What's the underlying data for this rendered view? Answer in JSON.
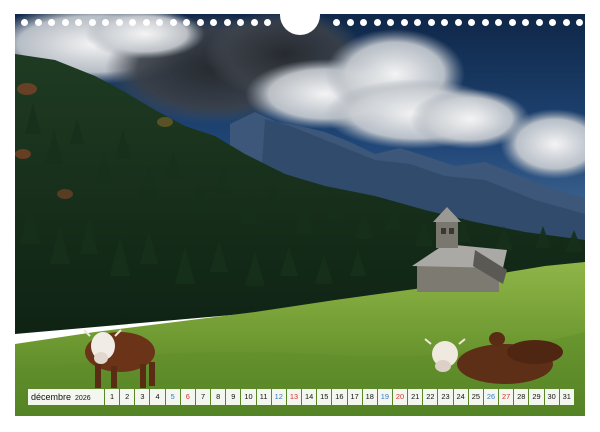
{
  "calendar": {
    "month": "décembre",
    "year": "2026",
    "days": [
      {
        "n": "1",
        "type": "weekday"
      },
      {
        "n": "2",
        "type": "weekday"
      },
      {
        "n": "3",
        "type": "weekday"
      },
      {
        "n": "4",
        "type": "weekday"
      },
      {
        "n": "5",
        "type": "sat"
      },
      {
        "n": "6",
        "type": "sun"
      },
      {
        "n": "7",
        "type": "weekday"
      },
      {
        "n": "8",
        "type": "weekday"
      },
      {
        "n": "9",
        "type": "weekday"
      },
      {
        "n": "10",
        "type": "weekday"
      },
      {
        "n": "11",
        "type": "weekday"
      },
      {
        "n": "12",
        "type": "sat"
      },
      {
        "n": "13",
        "type": "sun"
      },
      {
        "n": "14",
        "type": "weekday"
      },
      {
        "n": "15",
        "type": "weekday"
      },
      {
        "n": "16",
        "type": "weekday"
      },
      {
        "n": "17",
        "type": "weekday"
      },
      {
        "n": "18",
        "type": "weekday"
      },
      {
        "n": "19",
        "type": "sat"
      },
      {
        "n": "20",
        "type": "sun"
      },
      {
        "n": "21",
        "type": "weekday"
      },
      {
        "n": "22",
        "type": "weekday"
      },
      {
        "n": "23",
        "type": "weekday"
      },
      {
        "n": "24",
        "type": "weekday"
      },
      {
        "n": "25",
        "type": "weekday"
      },
      {
        "n": "26",
        "type": "sat"
      },
      {
        "n": "27",
        "type": "sun"
      },
      {
        "n": "28",
        "type": "weekday"
      },
      {
        "n": "29",
        "type": "weekday"
      },
      {
        "n": "30",
        "type": "weekday"
      },
      {
        "n": "31",
        "type": "weekday"
      }
    ]
  },
  "colors": {
    "weekday": "#111111",
    "saturday": "#3a78c8",
    "sunday": "#d0342c"
  },
  "photo": {
    "elements": [
      "cloudy-sky",
      "mountain-range",
      "conifer-forest",
      "alpine-meadow",
      "stone-chapel",
      "cow-standing",
      "cow-lying",
      "cow-resting-background"
    ]
  }
}
